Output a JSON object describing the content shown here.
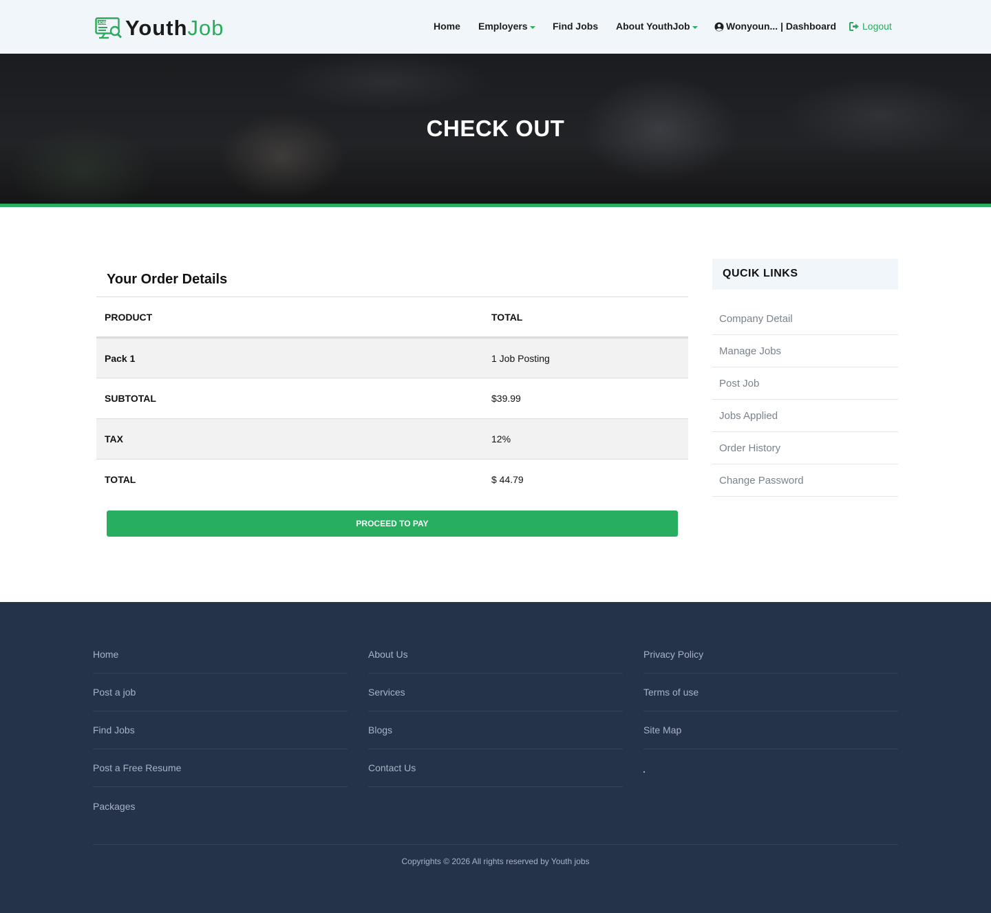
{
  "brand": {
    "name_main": "Youth",
    "name_accent": "Job",
    "accent_color": "#2aaa5c",
    "logo_icon": "job-search-monitor-icon",
    "logo_badge": "JOB"
  },
  "nav": {
    "home": "Home",
    "employers": "Employers",
    "find_jobs": "Find Jobs",
    "about": "About YouthJob",
    "user": "Wonyoun... | Dashboard",
    "logout": "Logout"
  },
  "banner": {
    "title": "CHECK OUT",
    "accent_color": "#27ae60"
  },
  "order": {
    "title": "Your Order Details",
    "columns": [
      "PRODUCT",
      "TOTAL"
    ],
    "rows": [
      {
        "label": "Pack 1",
        "value": "1 Job Posting"
      },
      {
        "label": "SUBTOTAL",
        "value": "$39.99"
      },
      {
        "label": "TAX",
        "value": "12%"
      },
      {
        "label": "TOTAL",
        "value": "$ 44.79"
      }
    ],
    "pay_button": "PROCEED TO PAY",
    "button_color": "#27ae60"
  },
  "quick_links": {
    "title": "QUCIK LINKS",
    "items": [
      "Company Detail",
      "Manage Jobs",
      "Post Job",
      "Jobs Applied",
      "Order History",
      "Change Password"
    ]
  },
  "footer": {
    "background": "#24324a",
    "col1": [
      "Home",
      "Post a job",
      "Find Jobs",
      "Post a Free Resume",
      "Packages"
    ],
    "col2": [
      "About Us",
      "Services",
      "Blogs",
      "Contact Us"
    ],
    "col3": [
      "Privacy Policy",
      "Terms of use",
      "Site Map"
    ],
    "copyright": "Copyrights © 2026 All rights reserved by Youth jobs"
  }
}
